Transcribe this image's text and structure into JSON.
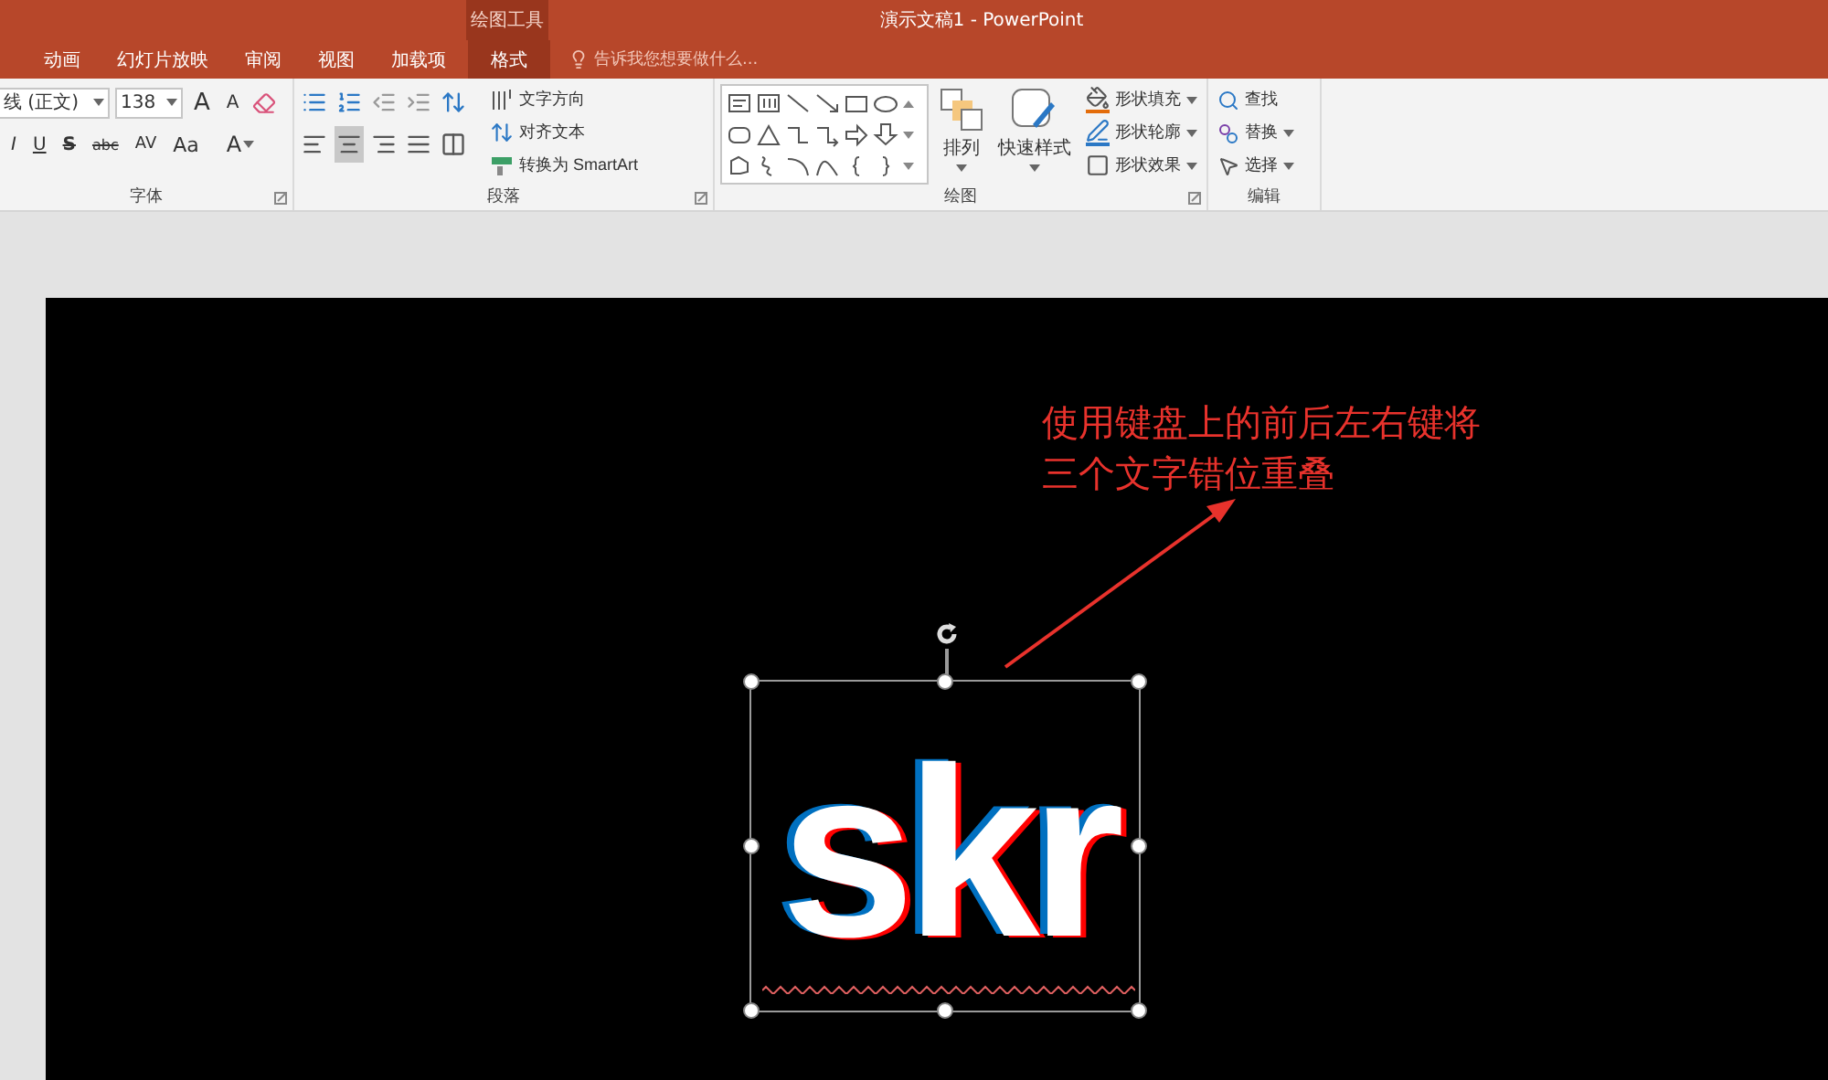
{
  "title_bar": {
    "context_label": "绘图工具",
    "title": "演示文稿1 - PowerPoint"
  },
  "tabs": [
    {
      "label": "动画",
      "selected": false
    },
    {
      "label": "幻灯片放映",
      "selected": false
    },
    {
      "label": "审阅",
      "selected": false
    },
    {
      "label": "视图",
      "selected": false
    },
    {
      "label": "加载项",
      "selected": false
    },
    {
      "label": "格式",
      "selected": true
    }
  ],
  "tell_me": {
    "placeholder": "告诉我您想要做什么..."
  },
  "font_group": {
    "label": "字体",
    "font_name": "线 (正文)",
    "font_size": "138",
    "size_buttons": [
      "A",
      "A"
    ],
    "format_buttons": [
      "I",
      "U",
      "S",
      "abc",
      "AV",
      "Aa"
    ],
    "color_button": "A"
  },
  "paragraph_group": {
    "label": "段落",
    "alignments": [
      {
        "kind": "left",
        "selected": false
      },
      {
        "kind": "center",
        "selected": true
      },
      {
        "kind": "right",
        "selected": false
      },
      {
        "kind": "justify",
        "selected": false
      },
      {
        "kind": "distributed",
        "selected": false
      }
    ],
    "commands": [
      "文字方向",
      "对齐文本",
      "转换为 SmartArt"
    ]
  },
  "drawing_group": {
    "label": "绘图",
    "arrange": "排列",
    "quick_styles": "快速样式",
    "commands": [
      "形状填充",
      "形状轮廓",
      "形状效果"
    ]
  },
  "editing_group": {
    "label": "编辑",
    "commands": [
      "查找",
      "替换",
      "选择"
    ]
  },
  "slide": {
    "annotation": "使用键盘上的前后左右键将三个文字错位重叠",
    "big_text": {
      "text": "skr",
      "color": "#ffffff"
    }
  }
}
